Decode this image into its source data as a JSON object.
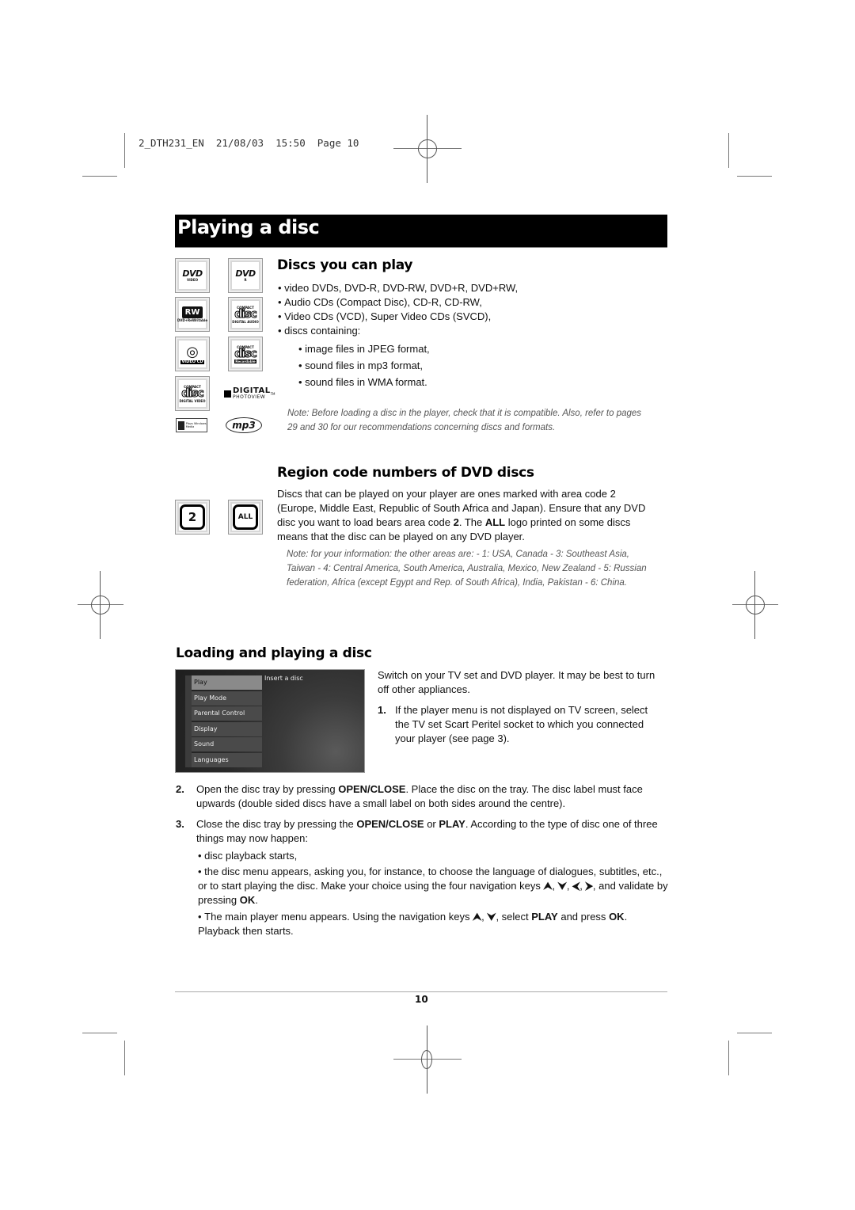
{
  "print_slug": "2_DTH231_EN  21/08/03  15:50  Page 10",
  "page_title": "Playing a disc",
  "sections": {
    "discs": {
      "heading": "Discs you can play",
      "items": [
        "video DVDs, DVD-R, DVD-RW, DVD+R, DVD+RW,",
        "Audio CDs (Compact Disc), CD-R, CD-RW,",
        "Video CDs (VCD), Super Video CDs (SVCD),",
        "discs containing:"
      ],
      "subitems": [
        "image files in JPEG format,",
        "sound files in mp3 format,",
        "sound files in WMA format."
      ],
      "note": "Note: Before loading a disc in the player, check that it is compatible. Also, refer to pages 29 and 30 for our recommendations concerning discs and formats.",
      "logos": {
        "dvd_video": {
          "main": "DVD",
          "sub": "VIDEO"
        },
        "dvd_r": {
          "main": "DVD",
          "sub": "R"
        },
        "rw": {
          "main": "RW",
          "sub": "DVD+ReWritable"
        },
        "cd_audio": {
          "top": "COMPACT",
          "main": "disc",
          "sub": "DIGITAL AUDIO"
        },
        "video_cd": {
          "main": "VIDEO CD"
        },
        "cd_recordable": {
          "top": "COMPACT",
          "main": "disc",
          "sub": "Recordable"
        },
        "cd_video": {
          "top": "COMPACT",
          "main": "disc",
          "sub": "DIGITAL VIDEO"
        },
        "photoview": {
          "main": "DIGITAL",
          "sub": "PHOTOVIEW",
          "tm": "TM"
        },
        "windows_media": {
          "main": "Plays Windows Media"
        },
        "mp3": {
          "main": "mp3"
        }
      }
    },
    "region": {
      "heading": "Region code numbers of DVD discs",
      "para_1": "Discs that can be played on your player are ones marked with area code 2 (Europe, Middle East, Republic of South Africa and Japan). Ensure that any DVD disc you want to load bears area code ",
      "para_bold_1": "2",
      "para_2": ". The ",
      "para_bold_2": "ALL",
      "para_3": " logo printed on some discs means that the disc can be played on any DVD player.",
      "note": "Note: for your information: the other areas are: - 1: USA, Canada - 3: Southeast Asia, Taiwan - 4: Central America, South America, Australia, Mexico, New Zealand - 5: Russian federation, Africa (except Egypt and Rep. of South Africa), India, Pakistan - 6: China.",
      "logo_2": "2",
      "logo_all": "ALL"
    },
    "loading": {
      "heading": "Loading and playing a disc",
      "menu": {
        "items": [
          "Play",
          "Play Mode",
          "Parental Control",
          "Display",
          "Sound",
          "Languages"
        ],
        "selected": "Play",
        "hint": "Insert a disc"
      },
      "intro": "Switch on your TV set and DVD player. It may be best to turn off other appliances.",
      "step1_num": "1.",
      "step1": "If the player menu is not displayed on TV screen, select the TV set Scart Peritel socket to which you connected your player (see page 3).",
      "step2_num": "2.",
      "step2_a": "Open the disc tray by pressing ",
      "step2_b": "OPEN/CLOSE",
      "step2_c": ". Place the disc on the tray. The disc label must face upwards (double sided discs have a small label on both sides around the centre).",
      "step3_num": "3.",
      "step3_a": "Close the disc tray by pressing the ",
      "step3_b": "OPEN/CLOSE",
      "step3_c": " or ",
      "step3_d": "PLAY",
      "step3_e": ". According to the type of disc one of three things may now happen:",
      "outcome1": "disc playback starts,",
      "outcome2_a": "the disc menu appears, asking you, for instance, to choose the language of dialogues, subtitles, etc., or to start playing the disc. Make your choice using the four navigation keys ",
      "outcome2_b": ", and validate by pressing ",
      "outcome2_ok": "OK",
      "outcome3_a": "The main player menu appears. Using the navigation keys ",
      "outcome3_b": ", select ",
      "outcome3_play": "PLAY",
      "outcome3_c": " and press ",
      "outcome3_ok": "OK",
      "outcome3_d": ". Playback then starts.",
      "key_up": "⮝",
      "key_down": "⮟",
      "key_left": "⮜",
      "key_right": "⮞"
    }
  },
  "page_number": "10"
}
